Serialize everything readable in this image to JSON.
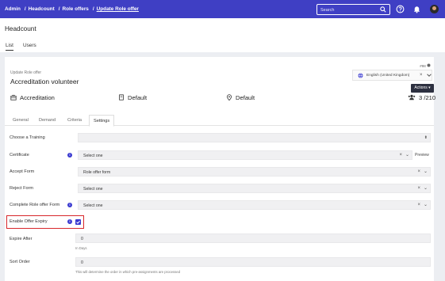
{
  "breadcrumb": {
    "items": [
      "Admin",
      "Headcount",
      "Role offers"
    ],
    "current": "Update Role offer",
    "separator": "/"
  },
  "search": {
    "placeholder": "Search"
  },
  "colors": {
    "topbar": "#3f3fc4",
    "accent": "#3a3ad0",
    "highlight": "#d7262b",
    "actions": "#2d3040"
  },
  "icons": [
    "search-icon",
    "help-icon",
    "bell-icon",
    "avatar",
    "globe-icon",
    "briefcase-icon",
    "building-icon",
    "location-pin-icon",
    "users-icon",
    "info-icon",
    "chevron-down-icon",
    "clear-icon",
    "check-icon"
  ],
  "header": {
    "title": "Headcount",
    "tabs": [
      "List",
      "Users"
    ],
    "active_tab": "List"
  },
  "card": {
    "id_label": "#98",
    "subtitle": "Update Role offer",
    "title": "Accreditation volunteer",
    "language": "English (United Kingdom)",
    "actions_label": "Actions ▾",
    "info": {
      "role": "Accreditation",
      "template": "Default",
      "location": "Default",
      "count": "3 /210"
    },
    "tabs": [
      "General",
      "Demand",
      "Criteria",
      "Settings"
    ],
    "active_tab": "Settings"
  },
  "form": {
    "training": {
      "label": "Choose a Training",
      "value": ""
    },
    "certificate": {
      "label": "Certificate",
      "value": "Select one",
      "preview": "Preview"
    },
    "accept_form": {
      "label": "Accept Form",
      "value": "Role offer form"
    },
    "reject_form": {
      "label": "Reject Form",
      "value": "Select one"
    },
    "complete_form": {
      "label": "Complete Role offer Form",
      "value": "Select one"
    },
    "enable_expiry": {
      "label": "Enable Offer Expiry",
      "checked": true
    },
    "expire_after": {
      "label": "Expire After",
      "value": "0",
      "hint": "In Days"
    },
    "sort_order": {
      "label": "Sort Order",
      "value": "0",
      "hint": "This will determine the order in which pre-assignments are processed"
    }
  }
}
